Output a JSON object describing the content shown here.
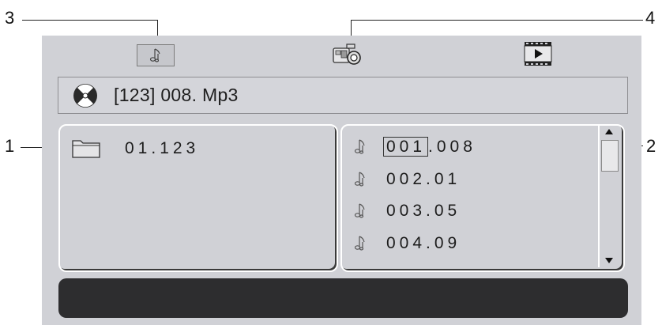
{
  "callouts": [
    "1",
    "2",
    "3",
    "4"
  ],
  "tabs": [
    {
      "name": "music",
      "icon": "music-note-icon",
      "selected": true
    },
    {
      "name": "photo",
      "icon": "camera-icon",
      "selected": false
    },
    {
      "name": "video",
      "icon": "film-play-icon",
      "selected": false
    }
  ],
  "now_playing": {
    "icon": "disc-icon",
    "text": "[123] 008. Mp3"
  },
  "folders": [
    {
      "icon": "folder-icon",
      "label": "01.123"
    }
  ],
  "files": [
    {
      "icon": "music-note-icon",
      "prefix": "001",
      "suffix": ".008",
      "selected": true
    },
    {
      "icon": "music-note-icon",
      "label": "002.01"
    },
    {
      "icon": "music-note-icon",
      "label": "003.05"
    },
    {
      "icon": "music-note-icon",
      "label": "004.09"
    }
  ],
  "colors": {
    "screen_bg": "#d0d1d6",
    "info_bar": "#2d2d2f",
    "panel_border": "#ffffff"
  }
}
